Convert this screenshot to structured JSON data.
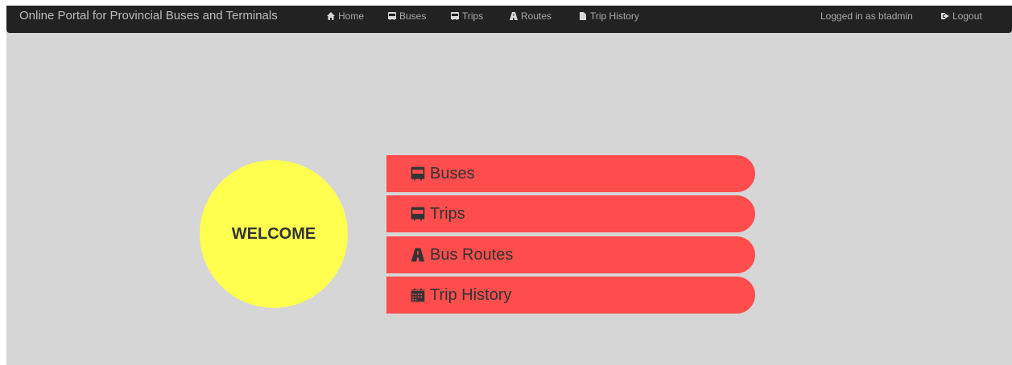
{
  "navbar": {
    "brand": "Online Portal for Provincial Buses and Terminals",
    "items": [
      {
        "label": "Home",
        "icon": "home-icon"
      },
      {
        "label": "Buses",
        "icon": "bus-icon"
      },
      {
        "label": "Trips",
        "icon": "bus-icon"
      },
      {
        "label": "Routes",
        "icon": "road-icon"
      },
      {
        "label": "Trip History",
        "icon": "file-icon"
      }
    ],
    "logged_in": "Logged in as btadmin",
    "logout": {
      "label": "Logout",
      "icon": "logout-icon"
    }
  },
  "welcome": {
    "text": "WELCOME",
    "color": "#ffff4f"
  },
  "menu": {
    "color": "#ff4d4d",
    "items": [
      {
        "label": "Buses",
        "icon": "bus-icon"
      },
      {
        "label": "Trips",
        "icon": "bus-icon"
      },
      {
        "label": "Bus Routes",
        "icon": "road-icon"
      },
      {
        "label": "Trip History",
        "icon": "calendar-icon"
      }
    ]
  }
}
